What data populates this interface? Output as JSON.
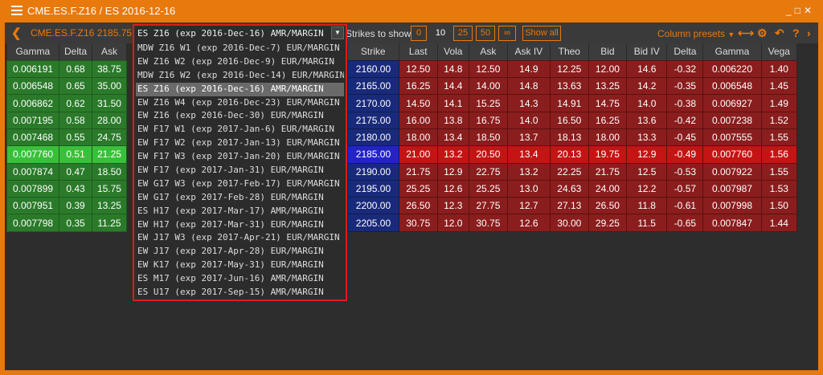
{
  "titlebar": {
    "title": "CME.ES.F.Z16 / ES 2016-12-16"
  },
  "toolbar": {
    "symbol": "CME.ES.F.Z16 2185.75",
    "strikes_label": "Strikes to show:",
    "strike_counts": [
      "0",
      "10",
      "25",
      "50",
      "∞"
    ],
    "active_count": "10",
    "show_all": "Show all",
    "column_presets": "Column presets"
  },
  "expiry_dropdown": {
    "selected": "ES Z16 (exp 2016-Dec-16) AMR/MARGIN",
    "options": [
      "MDW Z16 W1 (exp 2016-Dec-7) EUR/MARGIN",
      "EW Z16 W2 (exp 2016-Dec-9) EUR/MARGIN",
      "MDW Z16 W2 (exp 2016-Dec-14) EUR/MARGIN",
      "ES Z16 (exp 2016-Dec-16) AMR/MARGIN",
      "EW Z16 W4 (exp 2016-Dec-23) EUR/MARGIN",
      "EW Z16 (exp 2016-Dec-30) EUR/MARGIN",
      "EW F17 W1 (exp 2017-Jan-6) EUR/MARGIN",
      "EW F17 W2 (exp 2017-Jan-13) EUR/MARGIN",
      "EW F17 W3 (exp 2017-Jan-20) EUR/MARGIN",
      "EW F17 (exp 2017-Jan-31) EUR/MARGIN",
      "EW G17 W3 (exp 2017-Feb-17) EUR/MARGIN",
      "EW G17 (exp 2017-Feb-28) EUR/MARGIN",
      "ES H17 (exp 2017-Mar-17) AMR/MARGIN",
      "EW H17 (exp 2017-Mar-31) EUR/MARGIN",
      "EW J17 W3 (exp 2017-Apr-21) EUR/MARGIN",
      "EW J17 (exp 2017-Apr-28) EUR/MARGIN",
      "EW K17 (exp 2017-May-31) EUR/MARGIN",
      "ES M17 (exp 2017-Jun-16) AMR/MARGIN",
      "ES U17 (exp 2017-Sep-15) AMR/MARGIN"
    ],
    "selected_index": 3
  },
  "calls_table": {
    "columns": [
      "Gamma",
      "Delta",
      "Ask"
    ],
    "rows": [
      [
        "0.006191",
        "0.68",
        "38.75"
      ],
      [
        "0.006548",
        "0.65",
        "35.00"
      ],
      [
        "0.006862",
        "0.62",
        "31.50"
      ],
      [
        "0.007195",
        "0.58",
        "28.00"
      ],
      [
        "0.007468",
        "0.55",
        "24.75"
      ],
      [
        "0.007760",
        "0.51",
        "21.25"
      ],
      [
        "0.007874",
        "0.47",
        "18.50"
      ],
      [
        "0.007899",
        "0.43",
        "15.75"
      ],
      [
        "0.007951",
        "0.39",
        "13.25"
      ],
      [
        "0.007798",
        "0.35",
        "11.25"
      ]
    ]
  },
  "puts_table": {
    "columns": [
      "Strike",
      "Last",
      "Vola",
      "Ask",
      "Ask IV",
      "Theo",
      "Bid",
      "Bid IV",
      "Delta",
      "Gamma",
      "Vega"
    ],
    "rows": [
      [
        "2160.00",
        "12.50",
        "14.8",
        "12.50",
        "14.9",
        "12.25",
        "12.00",
        "14.6",
        "-0.32",
        "0.006220",
        "1.40"
      ],
      [
        "2165.00",
        "16.25",
        "14.4",
        "14.00",
        "14.8",
        "13.63",
        "13.25",
        "14.2",
        "-0.35",
        "0.006548",
        "1.45"
      ],
      [
        "2170.00",
        "14.50",
        "14.1",
        "15.25",
        "14.3",
        "14.91",
        "14.75",
        "14.0",
        "-0.38",
        "0.006927",
        "1.49"
      ],
      [
        "2175.00",
        "16.00",
        "13.8",
        "16.75",
        "14.0",
        "16.50",
        "16.25",
        "13.6",
        "-0.42",
        "0.007238",
        "1.52"
      ],
      [
        "2180.00",
        "18.00",
        "13.4",
        "18.50",
        "13.7",
        "18.13",
        "18.00",
        "13.3",
        "-0.45",
        "0.007555",
        "1.55"
      ],
      [
        "2185.00",
        "21.00",
        "13.2",
        "20.50",
        "13.4",
        "20.13",
        "19.75",
        "12.9",
        "-0.49",
        "0.007760",
        "1.56"
      ],
      [
        "2190.00",
        "21.75",
        "12.9",
        "22.75",
        "13.2",
        "22.25",
        "21.75",
        "12.5",
        "-0.53",
        "0.007922",
        "1.55"
      ],
      [
        "2195.00",
        "25.25",
        "12.6",
        "25.25",
        "13.0",
        "24.63",
        "24.00",
        "12.2",
        "-0.57",
        "0.007987",
        "1.53"
      ],
      [
        "2200.00",
        "26.50",
        "12.3",
        "27.75",
        "12.7",
        "27.13",
        "26.50",
        "11.8",
        "-0.61",
        "0.007998",
        "1.50"
      ],
      [
        "2205.00",
        "30.75",
        "12.0",
        "30.75",
        "12.6",
        "30.00",
        "29.25",
        "11.5",
        "-0.65",
        "0.007847",
        "1.44"
      ]
    ],
    "atm_index": 5
  },
  "colors": {
    "accent": "#e8790c",
    "call_cell": "#2a7a2a",
    "put_cell": "#8a1d1d",
    "strike_cell": "#1a2a7a",
    "highlight_border": "#e21a1a"
  }
}
